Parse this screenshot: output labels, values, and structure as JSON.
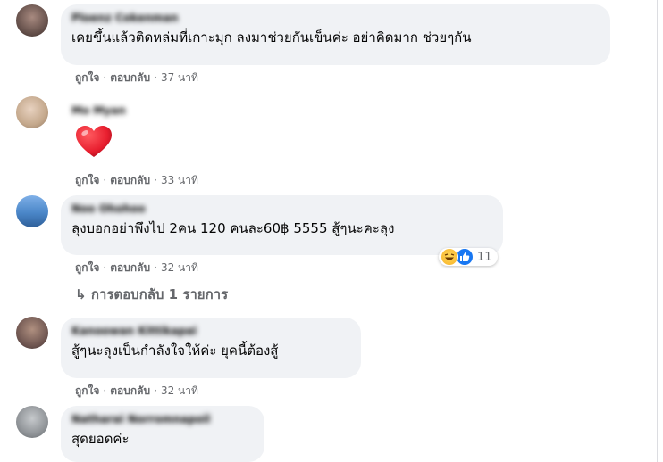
{
  "actions": {
    "like": "ถูกใจ",
    "reply": "ตอบกลับ",
    "separator": "·"
  },
  "comments": [
    {
      "name": "Ploenz Cokenman",
      "text": "เคยขึ้นแล้วติดหล่มที่เกาะมุก ลงมาช่วยกันเข็นค่ะ อย่าคิดมาก ช่วยๆกัน",
      "time": "37 นาที"
    },
    {
      "name": "Mo Myan",
      "text": "",
      "sticker": "heart",
      "time": "33 นาที"
    },
    {
      "name": "Noo Ohohoo",
      "text": "ลุงบอกอย่าพึงไป 2คน 120 คนละ60฿ 5555 สู้ๆนะคะลุง",
      "time": "32 นาที",
      "reaction_count": "11",
      "reactions": [
        "haha",
        "like"
      ]
    },
    {
      "name": "Kanoowan Kittikapai",
      "text": "สู้ๆนะลุงเป็นกำลังใจให้ค่ะ ยุคนี้ต้องสู้",
      "time": "32 นาที"
    },
    {
      "name": "Natharai Norromnapoil",
      "text": "สุดยอดค่ะ"
    }
  ],
  "replies_link": {
    "arrow": "↳",
    "label": "การตอบกลับ 1 รายการ"
  },
  "colors": {
    "bubble": "#f0f2f5",
    "meta": "#65676b",
    "text": "#050505",
    "heart": "#e81f2f"
  }
}
